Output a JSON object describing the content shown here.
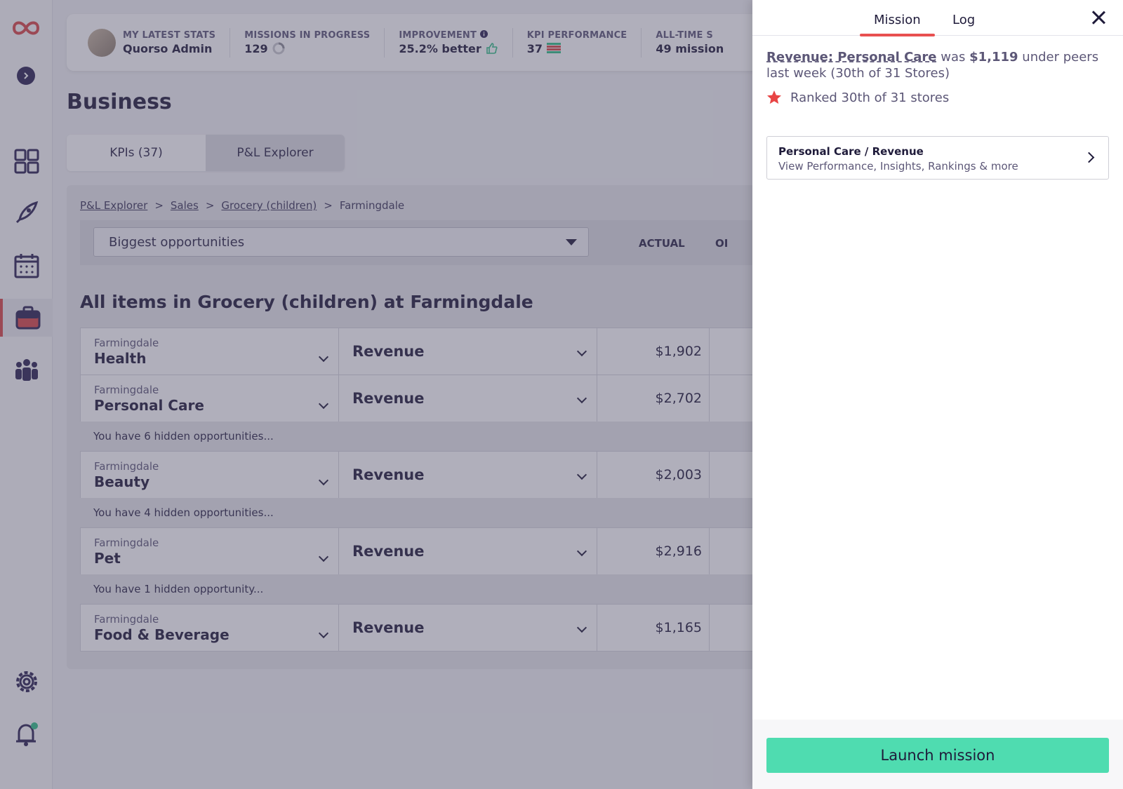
{
  "stats": [
    {
      "label": "MY LATEST STATS",
      "value": "Quorso Admin"
    },
    {
      "label": "MISSIONS IN PROGRESS",
      "value": "129"
    },
    {
      "label": "IMPROVEMENT",
      "value": "25.2% better"
    },
    {
      "label": "KPI PERFORMANCE",
      "value": "37"
    },
    {
      "label": "ALL-TIME S",
      "value": "49 mission"
    }
  ],
  "page_title": "Business",
  "tabs": [
    {
      "label": "KPIs (37)"
    },
    {
      "label": "P&L Explorer"
    }
  ],
  "breadcrumb": [
    "P&L Explorer",
    "Sales",
    "Grocery (children)",
    "Farmingdale"
  ],
  "breadcrumb_sep": ">",
  "filter": {
    "selected": "Biggest opportunities"
  },
  "columns": {
    "actual": "ACTUAL",
    "other": "OI"
  },
  "section_title": "All items in Grocery (children) at Farmingdale",
  "rows": [
    {
      "store": "Farmingdale",
      "category": "Health",
      "metric": "Revenue",
      "actual": "$1,902"
    },
    {
      "store": "Farmingdale",
      "category": "Personal Care",
      "metric": "Revenue",
      "actual": "$2,702"
    },
    {
      "store": "Farmingdale",
      "category": "Beauty",
      "metric": "Revenue",
      "actual": "$2,003"
    },
    {
      "store": "Farmingdale",
      "category": "Pet",
      "metric": "Revenue",
      "actual": "$2,916"
    },
    {
      "store": "Farmingdale",
      "category": "Food & Beverage",
      "metric": "Revenue",
      "actual": "$1,165"
    }
  ],
  "hidden": [
    "You have 6 hidden opportunities...",
    "You have 4 hidden opportunities...",
    "You have 1 hidden opportunity..."
  ],
  "drawer": {
    "tabs": [
      "Mission",
      "Log"
    ],
    "summary_link": "Revenue: Personal Care",
    "summary_mid": " was ",
    "summary_amount": "$1,119",
    "summary_tail": " under peers last week (30th of 31 Stores)",
    "rank_text": "Ranked 30th of 31 stores",
    "card_title": "Personal Care / Revenue",
    "card_subtitle": "View Performance, Insights, Rankings & more",
    "launch_label": "Launch mission"
  },
  "colors": {
    "accent": "#e85050",
    "launch": "#4fdcb0",
    "navy": "#2a2150"
  }
}
